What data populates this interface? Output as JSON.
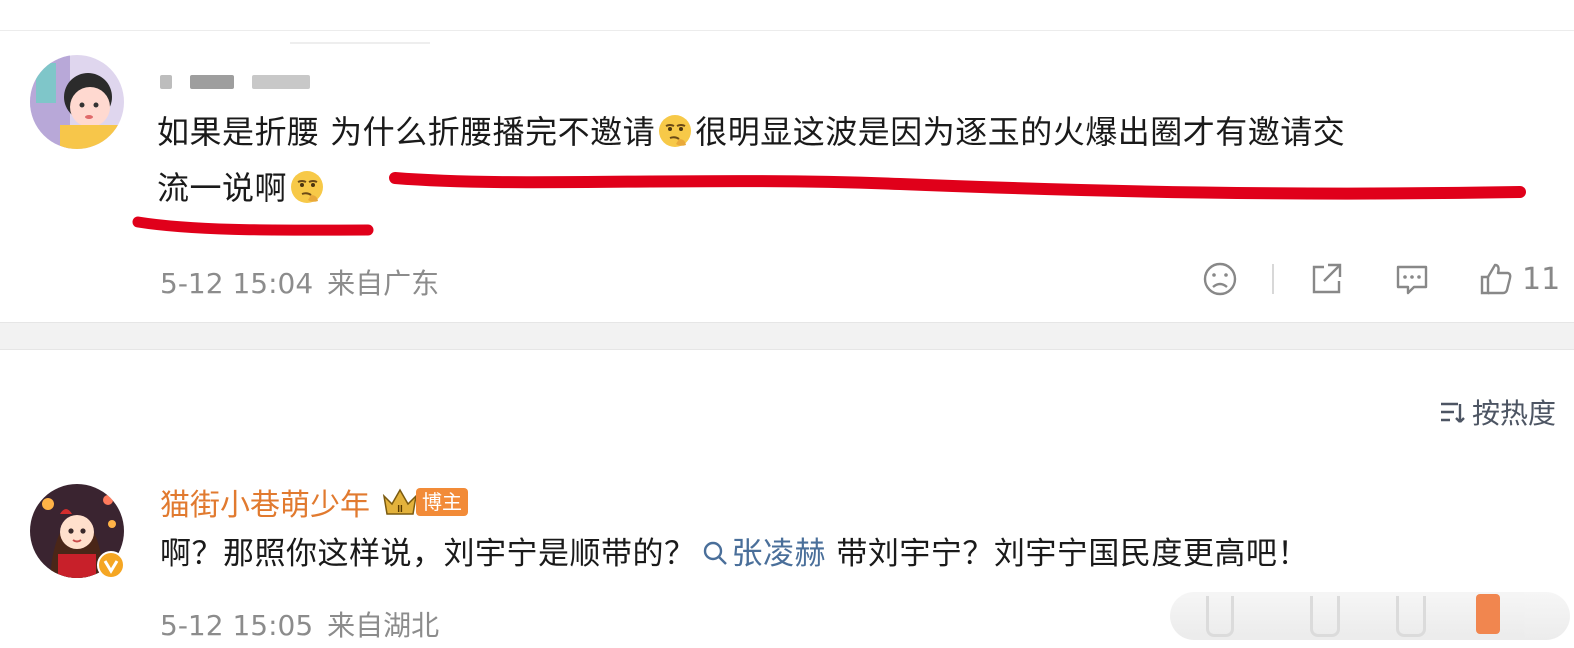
{
  "comment1": {
    "text_line1_a": "如果是折腰 为什么折腰播完不邀请",
    "text_line1_b": "很明显这波是因为逐玉的火爆出圈才有邀请交",
    "text_line2_a": "流一说啊",
    "emoji": "thinking-emoji",
    "date": "5-12 15:04",
    "location": "来自广东",
    "like_count": "11",
    "icons": [
      "dislike-icon",
      "share-icon",
      "comment-icon",
      "like-icon"
    ]
  },
  "sort": {
    "label": "按热度",
    "icon": "sort-icon"
  },
  "comment2": {
    "username": "猫街小巷萌少年",
    "badge": "博主",
    "text_a": "啊？那照你这样说，刘宇宁是顺带的？",
    "mention": "张凌赫",
    "text_b": " 带刘宇宁？刘宇宁国民度更高吧！",
    "date": "5-12 15:05",
    "location": "来自湖北"
  },
  "colors": {
    "username_orange": "#e17a2f",
    "mention_blue": "#4a6f9a",
    "red_annotation": "#e0001a",
    "meta_gray": "#8c8c8c"
  }
}
